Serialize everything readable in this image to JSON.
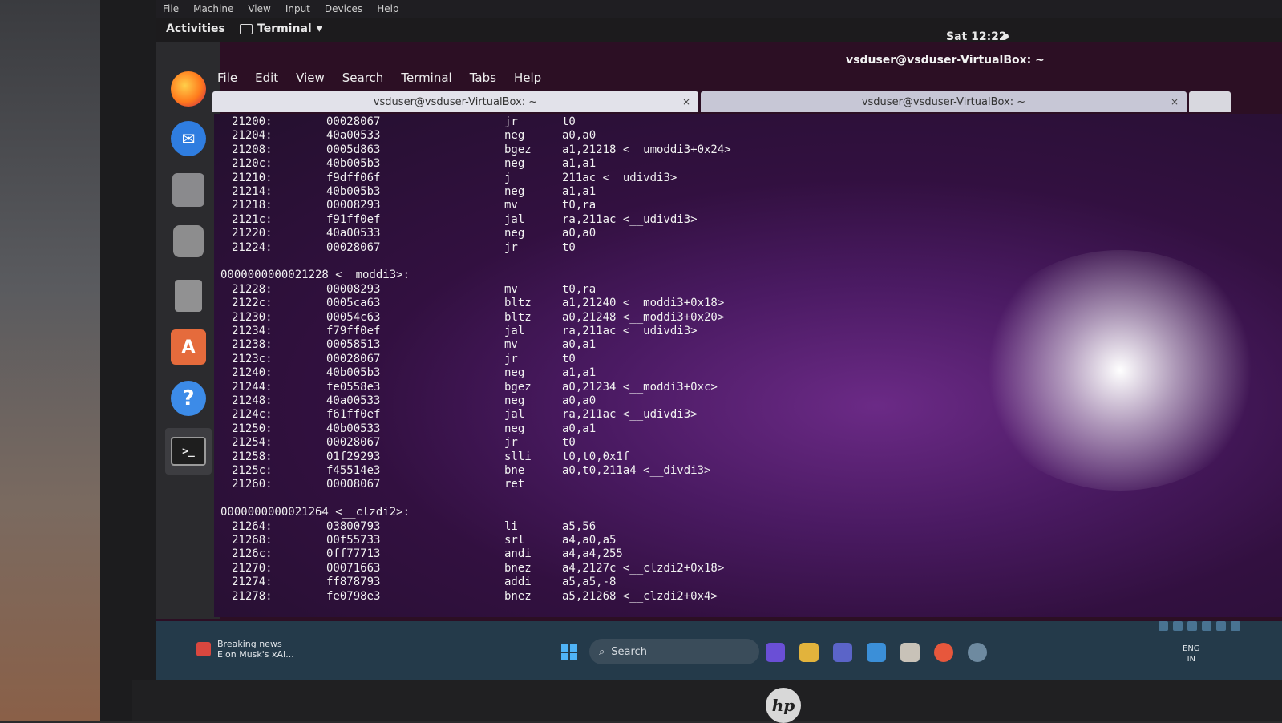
{
  "vbox_menu": [
    "File",
    "Machine",
    "View",
    "Input",
    "Devices",
    "Help"
  ],
  "top_bar": {
    "activities": "Activities",
    "app_name": "Terminal",
    "clock": "Sat 12:22"
  },
  "window_title": "vsduser@vsduser-VirtualBox: ~",
  "terminal_menu": [
    "File",
    "Edit",
    "View",
    "Search",
    "Terminal",
    "Tabs",
    "Help"
  ],
  "tabs": [
    {
      "label": "vsduser@vsduser-VirtualBox: ~",
      "close": "×"
    },
    {
      "label": "vsduser@vsduser-VirtualBox: ~",
      "close": "×"
    }
  ],
  "dock": [
    "firefox-icon",
    "thunderbird-icon",
    "files-icon",
    "rhythmbox-icon",
    "writer-icon",
    "software-icon",
    "help-icon",
    "terminal-icon"
  ],
  "dock_glyphs": {
    "software": "A",
    "help": "?",
    "terminal": ">_",
    "mail": "✉"
  },
  "disasm_block1": [
    {
      "addr": "21200:",
      "hex": "00028067",
      "mn": "jr",
      "op": "t0"
    },
    {
      "addr": "21204:",
      "hex": "40a00533",
      "mn": "neg",
      "op": "a0,a0"
    },
    {
      "addr": "21208:",
      "hex": "0005d863",
      "mn": "bgez",
      "op": "a1,21218 <__umoddi3+0x24>"
    },
    {
      "addr": "2120c:",
      "hex": "40b005b3",
      "mn": "neg",
      "op": "a1,a1"
    },
    {
      "addr": "21210:",
      "hex": "f9dff06f",
      "mn": "j",
      "op": "211ac <__udivdi3>"
    },
    {
      "addr": "21214:",
      "hex": "40b005b3",
      "mn": "neg",
      "op": "a1,a1"
    },
    {
      "addr": "21218:",
      "hex": "00008293",
      "mn": "mv",
      "op": "t0,ra"
    },
    {
      "addr": "2121c:",
      "hex": "f91ff0ef",
      "mn": "jal",
      "op": "ra,211ac <__udivdi3>"
    },
    {
      "addr": "21220:",
      "hex": "40a00533",
      "mn": "neg",
      "op": "a0,a0"
    },
    {
      "addr": "21224:",
      "hex": "00028067",
      "mn": "jr",
      "op": "t0"
    }
  ],
  "header2": "0000000000021228 <__moddi3>:",
  "disasm_block2": [
    {
      "addr": "21228:",
      "hex": "00008293",
      "mn": "mv",
      "op": "t0,ra"
    },
    {
      "addr": "2122c:",
      "hex": "0005ca63",
      "mn": "bltz",
      "op": "a1,21240 <__moddi3+0x18>"
    },
    {
      "addr": "21230:",
      "hex": "00054c63",
      "mn": "bltz",
      "op": "a0,21248 <__moddi3+0x20>"
    },
    {
      "addr": "21234:",
      "hex": "f79ff0ef",
      "mn": "jal",
      "op": "ra,211ac <__udivdi3>"
    },
    {
      "addr": "21238:",
      "hex": "00058513",
      "mn": "mv",
      "op": "a0,a1"
    },
    {
      "addr": "2123c:",
      "hex": "00028067",
      "mn": "jr",
      "op": "t0"
    },
    {
      "addr": "21240:",
      "hex": "40b005b3",
      "mn": "neg",
      "op": "a1,a1"
    },
    {
      "addr": "21244:",
      "hex": "fe0558e3",
      "mn": "bgez",
      "op": "a0,21234 <__moddi3+0xc>"
    },
    {
      "addr": "21248:",
      "hex": "40a00533",
      "mn": "neg",
      "op": "a0,a0"
    },
    {
      "addr": "2124c:",
      "hex": "f61ff0ef",
      "mn": "jal",
      "op": "ra,211ac <__udivdi3>"
    },
    {
      "addr": "21250:",
      "hex": "40b00533",
      "mn": "neg",
      "op": "a0,a1"
    },
    {
      "addr": "21254:",
      "hex": "00028067",
      "mn": "jr",
      "op": "t0"
    },
    {
      "addr": "21258:",
      "hex": "01f29293",
      "mn": "slli",
      "op": "t0,t0,0x1f"
    },
    {
      "addr": "2125c:",
      "hex": "f45514e3",
      "mn": "bne",
      "op": "a0,t0,211a4 <__divdi3>"
    },
    {
      "addr": "21260:",
      "hex": "00008067",
      "mn": "ret",
      "op": ""
    }
  ],
  "header3": "0000000000021264 <__clzdi2>:",
  "disasm_block3": [
    {
      "addr": "21264:",
      "hex": "03800793",
      "mn": "li",
      "op": "a5,56"
    },
    {
      "addr": "21268:",
      "hex": "00f55733",
      "mn": "srl",
      "op": "a4,a0,a5"
    },
    {
      "addr": "2126c:",
      "hex": "0ff77713",
      "mn": "andi",
      "op": "a4,a4,255"
    },
    {
      "addr": "21270:",
      "hex": "00071663",
      "mn": "bnez",
      "op": "a4,2127c <__clzdi2+0x18>"
    },
    {
      "addr": "21274:",
      "hex": "ff878793",
      "mn": "addi",
      "op": "a5,a5,-8"
    },
    {
      "addr": "21278:",
      "hex": "fe0798e3",
      "mn": "bnez",
      "op": "a5,21268 <__clzdi2+0x4>"
    }
  ],
  "taskbar": {
    "news_title": "Breaking news",
    "news_sub": "Elon Musk's xAI...",
    "search_placeholder": "Search",
    "lang": "ENG",
    "region": "IN",
    "hp_logo": "hp"
  },
  "colors": {
    "terminal_bg": "#321040",
    "taskbar": "#243a4a",
    "accent": "#4fb3f6"
  }
}
